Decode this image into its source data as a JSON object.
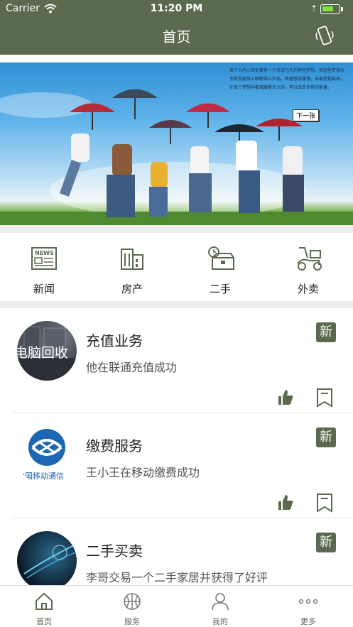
{
  "status_bar": {
    "carrier": "Carrier",
    "time": "11:20 PM",
    "battery_level": 0.7
  },
  "nav": {
    "title": "首页",
    "right_icon": "phone-shake-icon"
  },
  "banner": {
    "text": "每个人内心深处都有一个沉淀已久的神圣梦想，但这些梦想大多数没能够上眼睛得以实现。再理想成缓慢，未被挖掘出来。在每个梦想中都蕴藏着巨大的，可以改变世界的能量。",
    "next_label": "下一张"
  },
  "categories": [
    {
      "label": "新闻",
      "icon": "news-icon"
    },
    {
      "label": "房产",
      "icon": "building-icon"
    },
    {
      "label": "二手",
      "icon": "secondhand-icon"
    },
    {
      "label": "外卖",
      "icon": "scooter-icon"
    }
  ],
  "items": [
    {
      "title": "充值业务",
      "subtitle": "他在联通充值成功",
      "badge": "新",
      "avatar_text": "电脑回收"
    },
    {
      "title": "缴费服务",
      "subtitle": "王小王在移动缴费成功",
      "badge": "新",
      "avatar_text": "中国移动通信"
    },
    {
      "title": "二手买卖",
      "subtitle": "李哥交易一个二手家居并获得了好评",
      "badge": "新",
      "avatar_text": ""
    }
  ],
  "tabs": [
    {
      "label": "首页",
      "icon": "home-icon",
      "active": true
    },
    {
      "label": "服务",
      "icon": "basketball-icon",
      "active": false
    },
    {
      "label": "我的",
      "icon": "user-icon",
      "active": false
    },
    {
      "label": "更多",
      "icon": "more-icon",
      "active": false
    }
  ],
  "colors": {
    "primary": "#5a6a4e",
    "battery": "#7fe03a",
    "background": "#ededed"
  }
}
